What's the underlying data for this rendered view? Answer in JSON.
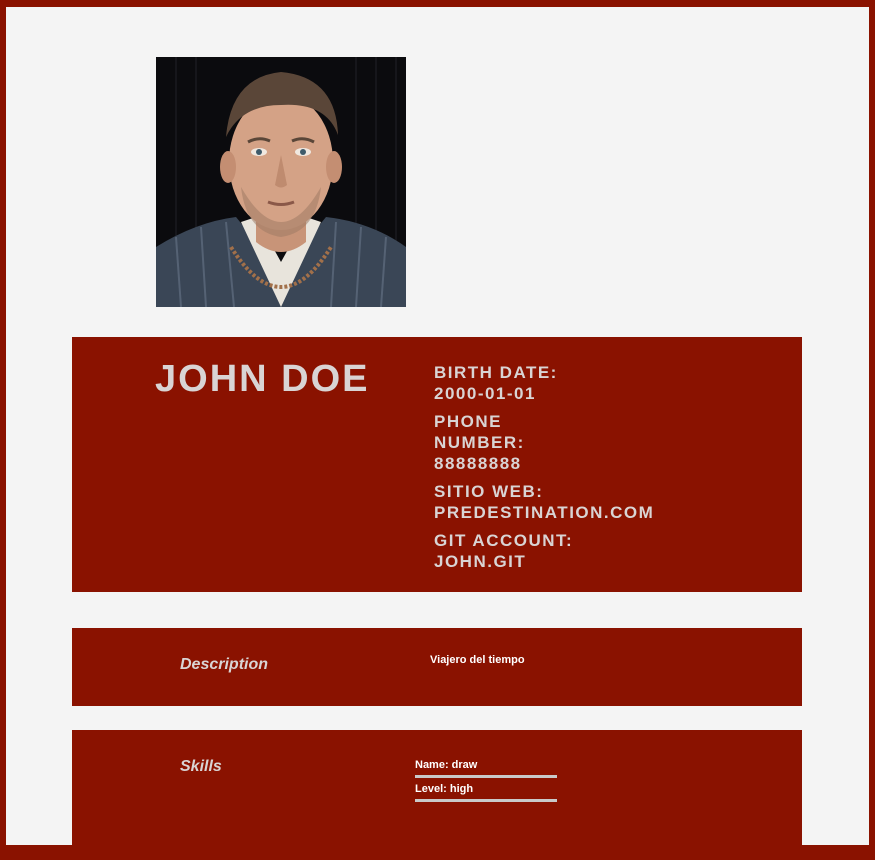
{
  "profile": {
    "photo_alt": "profile photo",
    "name": "JOHN DOE"
  },
  "info": {
    "birth_label": "BIRTH DATE:",
    "birth_value": "2000-01-01",
    "phone_label_1": "PHONE",
    "phone_label_2": "NUMBER:",
    "phone_value": "88888888",
    "web_label": "SITIO WEB:",
    "web_value": "PREDESTINATION.COM",
    "git_label": "GIT ACCOUNT:",
    "git_value": "JOHN.GIT"
  },
  "description": {
    "label": "Description",
    "text": "Viajero del tiempo"
  },
  "skills": {
    "label": "Skills",
    "name_line": "Name: draw",
    "level_line": "Level: high"
  },
  "colors": {
    "accent": "#8a1200",
    "page_bg": "#f4f4f4",
    "heading_text": "#d9d4d4",
    "divider": "#c9c9c9"
  }
}
